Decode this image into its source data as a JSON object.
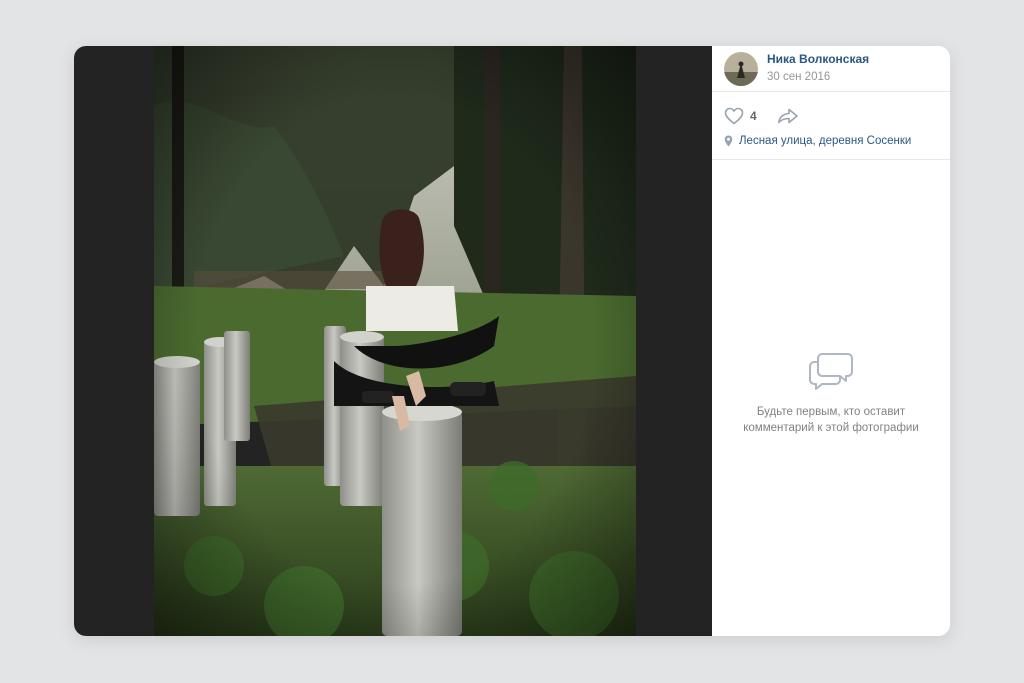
{
  "post": {
    "author_name": "Ника Волконская",
    "date": "30 сен 2016",
    "likes_count": "4",
    "location": "Лесная улица, деревня Сосенки"
  },
  "comments": {
    "empty_line_1": "Будьте первым, кто оставит",
    "empty_line_2": "комментарий к этой фотографии"
  },
  "icons": {
    "like": "heart-outline-icon",
    "share": "share-arrow-icon",
    "location": "location-pin-icon",
    "comments_empty": "speech-bubbles-icon"
  },
  "colors": {
    "link": "#2a5885",
    "muted": "#939699",
    "background": "#e3e4e6",
    "photo_frame": "#232323"
  }
}
